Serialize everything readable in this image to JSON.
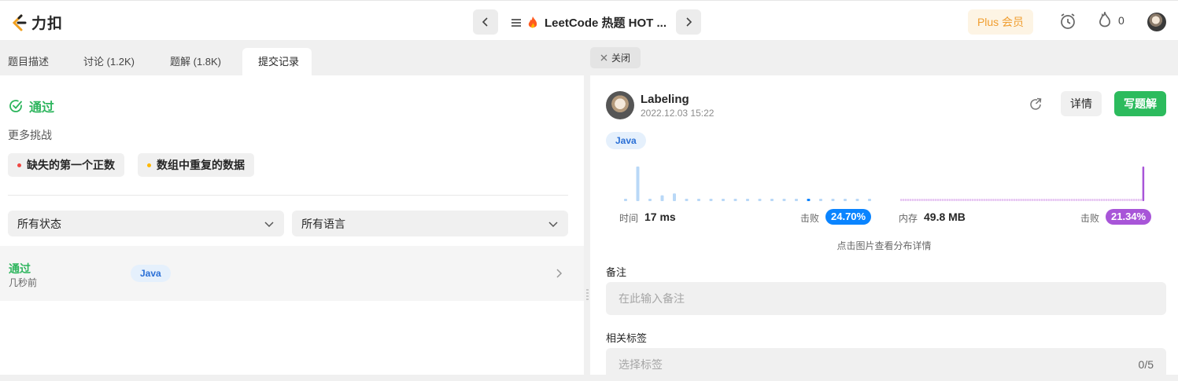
{
  "topbar": {
    "logo_text": "力扣",
    "title": "LeetCode 热题 HOT ...",
    "plus_label": "Plus 会员",
    "streak_count": "0",
    "icons": [
      "leetcode-logo-icon",
      "chevron-left-icon",
      "list-icon",
      "fire-icon",
      "chevron-right-icon",
      "alarm-clock-icon",
      "flame-icon",
      "avatar"
    ]
  },
  "left_panel": {
    "tabs": [
      {
        "label": "题目描述"
      },
      {
        "label": "讨论 (1.2K)"
      },
      {
        "label": "题解 (1.8K)"
      },
      {
        "label": "提交记录",
        "active": true
      }
    ],
    "status": "通过",
    "more_challenges_label": "更多挑战",
    "challenges": [
      {
        "label": "缺失的第一个正数",
        "dot_color": "#ef4743"
      },
      {
        "label": "数组中重复的数据",
        "dot_color": "#ffb800"
      }
    ],
    "filters": {
      "status": "所有状态",
      "language": "所有语言"
    },
    "submissions": [
      {
        "status": "通过",
        "time": "几秒前",
        "language": "Java"
      }
    ]
  },
  "right_panel": {
    "close_label": "关闭",
    "user": {
      "name": "Labeling",
      "date": "2022.12.03 15:22"
    },
    "detail_label": "详情",
    "write_solution_label": "写题解",
    "language": "Java",
    "runtime": {
      "label": "时间",
      "value": "17 ms",
      "beat_label": "击败",
      "beat": "24.70%",
      "color": "#0a84ff"
    },
    "memory": {
      "label": "内存",
      "value": "49.8 MB",
      "beat_label": "击败",
      "beat": "21.34%",
      "color": "#a855d8"
    },
    "chart_hint": "点击图片查看分布详情",
    "note_label": "备注",
    "note_placeholder": "在此输入备注",
    "tags_label": "相关标签",
    "tags_placeholder": "选择标签",
    "tags_count": "0/5"
  },
  "chart_data": [
    {
      "type": "bar",
      "series": [
        {
          "values": [
            1,
            18,
            1,
            3,
            4,
            1,
            1,
            1,
            1,
            1,
            1,
            1,
            1,
            1,
            1,
            1,
            1,
            1,
            1,
            1,
            1
          ]
        }
      ],
      "highlight_index": 15,
      "color": "#b9d8f7",
      "highlight_color": "#0a84ff"
    },
    {
      "type": "bar",
      "series": [
        {
          "values": [
            1,
            1,
            1,
            1,
            1,
            1,
            1,
            1,
            1,
            1,
            1,
            1,
            1,
            1,
            1,
            1,
            1,
            1,
            1,
            1,
            1,
            1,
            1,
            1,
            1,
            1,
            1,
            1,
            1,
            1,
            1,
            1,
            1,
            1,
            1,
            1,
            1,
            1,
            1,
            1,
            1,
            1,
            1,
            1,
            1,
            1,
            1,
            1,
            1,
            1,
            1,
            1,
            1,
            1,
            1,
            1,
            1,
            1,
            1,
            1,
            1,
            1,
            1,
            1,
            1,
            1,
            1,
            1,
            1,
            1,
            1,
            1,
            1,
            1,
            1,
            1,
            1,
            1,
            1,
            1,
            1,
            1,
            1,
            1,
            1,
            1,
            1,
            1,
            1,
            1,
            1,
            1,
            1,
            1,
            1,
            1,
            1,
            1,
            1,
            1,
            1,
            1,
            1,
            1,
            1,
            18
          ]
        }
      ],
      "highlight_index": 105,
      "color": "#e6c4f2",
      "highlight_color": "#a855d8"
    }
  ]
}
